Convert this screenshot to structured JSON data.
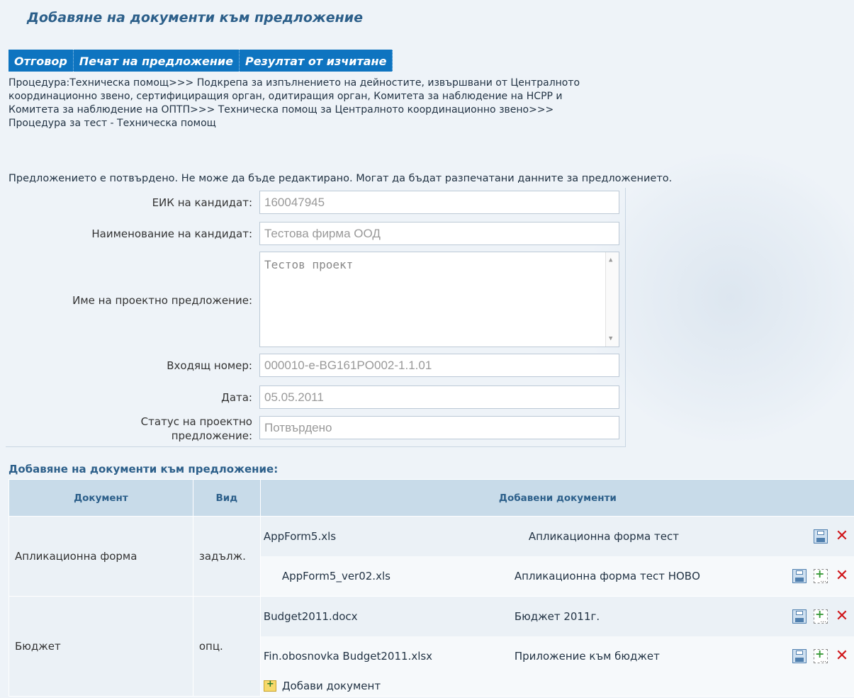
{
  "page": {
    "title": "Добавяне на документи към предложение"
  },
  "tabs": [
    "Отговор",
    "Печат на предложение",
    "Резултат от изчитане"
  ],
  "procedure_text": "Процедура:Техническа помощ>>> Подкрепа за изпълнението на дейностите, извършвани от Централното координационно звено, сертифициращия орган, одитиращия орган, Комитета за наблюдение на НСРР и Комитета за наблюдение на ОПТП>>> Техническа помощ за Централното координационно звено>>> Процедура за тест - Техническа помощ",
  "notice": "Предложението е потвърдено. Не може да бъде редактирано. Могат да бъдат разпечатани данните за предложението.",
  "form": {
    "eik": {
      "label": "ЕИК на кандидат:",
      "value": "160047945"
    },
    "name": {
      "label": "Наименование на кандидат:",
      "value": "Тестова фирма ООД"
    },
    "project": {
      "label": "Име на проектно предложение:",
      "value": "Тестов проект"
    },
    "incoming": {
      "label": "Входящ номер:",
      "value": "000010-e-BG161PO002-1.1.01"
    },
    "date": {
      "label": "Дата:",
      "value": "05.05.2011"
    },
    "status": {
      "label_line1": "Статус на проектно",
      "label_line2": "предложение:",
      "value": "Потвърдено"
    }
  },
  "docs_section": {
    "title": "Добавяне на документи към предложение:",
    "headers": {
      "document": "Документ",
      "kind": "Вид",
      "added": "Добавени документи"
    },
    "groups": [
      {
        "document": "Апликационна форма",
        "kind": "задълж.",
        "files": [
          {
            "name": "AppForm5.xls",
            "desc": "Апликационна форма тест"
          },
          {
            "name": "AppForm5_ver02.xls",
            "desc": "Апликационна форма тест НОВО"
          }
        ]
      },
      {
        "document": "Бюджет",
        "kind": "опц.",
        "files": [
          {
            "name": "Budget2011.docx",
            "desc": "Бюджет 2011г."
          },
          {
            "name": "Fin.obosnovka Budget2011.xlsx",
            "desc": "Приложение към бюджет"
          }
        ],
        "add_label": "Добави документ"
      }
    ]
  },
  "icons": {
    "save": "save-icon",
    "new_version": "add-version-icon",
    "delete": "delete-icon",
    "add": "add-document-icon"
  }
}
